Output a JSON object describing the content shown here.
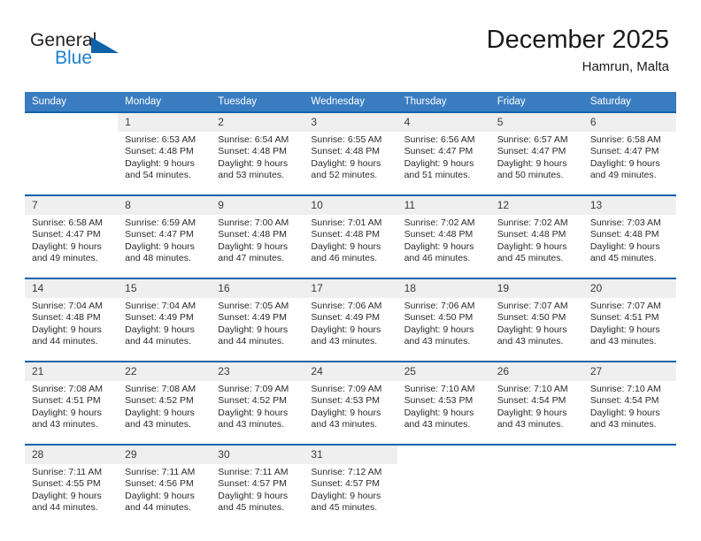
{
  "brand": {
    "name_part1": "General",
    "name_part2": "Blue",
    "triangle_color": "#1063a8",
    "blue_color": "#1d7fd0"
  },
  "header": {
    "month_title": "December 2025",
    "location": "Hamrun, Malta",
    "header_bg": "#3a7cc0",
    "separator_color": "#1063a8",
    "daynum_bg": "#efefef"
  },
  "weekday_headers": [
    "Sunday",
    "Monday",
    "Tuesday",
    "Wednesday",
    "Thursday",
    "Friday",
    "Saturday"
  ],
  "weeks": [
    {
      "days": [
        {
          "date": "",
          "lines": [
            "",
            "",
            "",
            ""
          ],
          "empty": true
        },
        {
          "date": "1",
          "lines": [
            "Sunrise: 6:53 AM",
            "Sunset: 4:48 PM",
            "Daylight: 9 hours",
            "and 54 minutes."
          ],
          "empty": false
        },
        {
          "date": "2",
          "lines": [
            "Sunrise: 6:54 AM",
            "Sunset: 4:48 PM",
            "Daylight: 9 hours",
            "and 53 minutes."
          ],
          "empty": false
        },
        {
          "date": "3",
          "lines": [
            "Sunrise: 6:55 AM",
            "Sunset: 4:48 PM",
            "Daylight: 9 hours",
            "and 52 minutes."
          ],
          "empty": false
        },
        {
          "date": "4",
          "lines": [
            "Sunrise: 6:56 AM",
            "Sunset: 4:47 PM",
            "Daylight: 9 hours",
            "and 51 minutes."
          ],
          "empty": false
        },
        {
          "date": "5",
          "lines": [
            "Sunrise: 6:57 AM",
            "Sunset: 4:47 PM",
            "Daylight: 9 hours",
            "and 50 minutes."
          ],
          "empty": false
        },
        {
          "date": "6",
          "lines": [
            "Sunrise: 6:58 AM",
            "Sunset: 4:47 PM",
            "Daylight: 9 hours",
            "and 49 minutes."
          ],
          "empty": false
        }
      ]
    },
    {
      "days": [
        {
          "date": "7",
          "lines": [
            "Sunrise: 6:58 AM",
            "Sunset: 4:47 PM",
            "Daylight: 9 hours",
            "and 49 minutes."
          ],
          "empty": false
        },
        {
          "date": "8",
          "lines": [
            "Sunrise: 6:59 AM",
            "Sunset: 4:47 PM",
            "Daylight: 9 hours",
            "and 48 minutes."
          ],
          "empty": false
        },
        {
          "date": "9",
          "lines": [
            "Sunrise: 7:00 AM",
            "Sunset: 4:48 PM",
            "Daylight: 9 hours",
            "and 47 minutes."
          ],
          "empty": false
        },
        {
          "date": "10",
          "lines": [
            "Sunrise: 7:01 AM",
            "Sunset: 4:48 PM",
            "Daylight: 9 hours",
            "and 46 minutes."
          ],
          "empty": false
        },
        {
          "date": "11",
          "lines": [
            "Sunrise: 7:02 AM",
            "Sunset: 4:48 PM",
            "Daylight: 9 hours",
            "and 46 minutes."
          ],
          "empty": false
        },
        {
          "date": "12",
          "lines": [
            "Sunrise: 7:02 AM",
            "Sunset: 4:48 PM",
            "Daylight: 9 hours",
            "and 45 minutes."
          ],
          "empty": false
        },
        {
          "date": "13",
          "lines": [
            "Sunrise: 7:03 AM",
            "Sunset: 4:48 PM",
            "Daylight: 9 hours",
            "and 45 minutes."
          ],
          "empty": false
        }
      ]
    },
    {
      "days": [
        {
          "date": "14",
          "lines": [
            "Sunrise: 7:04 AM",
            "Sunset: 4:48 PM",
            "Daylight: 9 hours",
            "and 44 minutes."
          ],
          "empty": false
        },
        {
          "date": "15",
          "lines": [
            "Sunrise: 7:04 AM",
            "Sunset: 4:49 PM",
            "Daylight: 9 hours",
            "and 44 minutes."
          ],
          "empty": false
        },
        {
          "date": "16",
          "lines": [
            "Sunrise: 7:05 AM",
            "Sunset: 4:49 PM",
            "Daylight: 9 hours",
            "and 44 minutes."
          ],
          "empty": false
        },
        {
          "date": "17",
          "lines": [
            "Sunrise: 7:06 AM",
            "Sunset: 4:49 PM",
            "Daylight: 9 hours",
            "and 43 minutes."
          ],
          "empty": false
        },
        {
          "date": "18",
          "lines": [
            "Sunrise: 7:06 AM",
            "Sunset: 4:50 PM",
            "Daylight: 9 hours",
            "and 43 minutes."
          ],
          "empty": false
        },
        {
          "date": "19",
          "lines": [
            "Sunrise: 7:07 AM",
            "Sunset: 4:50 PM",
            "Daylight: 9 hours",
            "and 43 minutes."
          ],
          "empty": false
        },
        {
          "date": "20",
          "lines": [
            "Sunrise: 7:07 AM",
            "Sunset: 4:51 PM",
            "Daylight: 9 hours",
            "and 43 minutes."
          ],
          "empty": false
        }
      ]
    },
    {
      "days": [
        {
          "date": "21",
          "lines": [
            "Sunrise: 7:08 AM",
            "Sunset: 4:51 PM",
            "Daylight: 9 hours",
            "and 43 minutes."
          ],
          "empty": false
        },
        {
          "date": "22",
          "lines": [
            "Sunrise: 7:08 AM",
            "Sunset: 4:52 PM",
            "Daylight: 9 hours",
            "and 43 minutes."
          ],
          "empty": false
        },
        {
          "date": "23",
          "lines": [
            "Sunrise: 7:09 AM",
            "Sunset: 4:52 PM",
            "Daylight: 9 hours",
            "and 43 minutes."
          ],
          "empty": false
        },
        {
          "date": "24",
          "lines": [
            "Sunrise: 7:09 AM",
            "Sunset: 4:53 PM",
            "Daylight: 9 hours",
            "and 43 minutes."
          ],
          "empty": false
        },
        {
          "date": "25",
          "lines": [
            "Sunrise: 7:10 AM",
            "Sunset: 4:53 PM",
            "Daylight: 9 hours",
            "and 43 minutes."
          ],
          "empty": false
        },
        {
          "date": "26",
          "lines": [
            "Sunrise: 7:10 AM",
            "Sunset: 4:54 PM",
            "Daylight: 9 hours",
            "and 43 minutes."
          ],
          "empty": false
        },
        {
          "date": "27",
          "lines": [
            "Sunrise: 7:10 AM",
            "Sunset: 4:54 PM",
            "Daylight: 9 hours",
            "and 43 minutes."
          ],
          "empty": false
        }
      ]
    },
    {
      "days": [
        {
          "date": "28",
          "lines": [
            "Sunrise: 7:11 AM",
            "Sunset: 4:55 PM",
            "Daylight: 9 hours",
            "and 44 minutes."
          ],
          "empty": false
        },
        {
          "date": "29",
          "lines": [
            "Sunrise: 7:11 AM",
            "Sunset: 4:56 PM",
            "Daylight: 9 hours",
            "and 44 minutes."
          ],
          "empty": false
        },
        {
          "date": "30",
          "lines": [
            "Sunrise: 7:11 AM",
            "Sunset: 4:57 PM",
            "Daylight: 9 hours",
            "and 45 minutes."
          ],
          "empty": false
        },
        {
          "date": "31",
          "lines": [
            "Sunrise: 7:12 AM",
            "Sunset: 4:57 PM",
            "Daylight: 9 hours",
            "and 45 minutes."
          ],
          "empty": false
        },
        {
          "date": "",
          "lines": [
            "",
            "",
            "",
            ""
          ],
          "empty": true
        },
        {
          "date": "",
          "lines": [
            "",
            "",
            "",
            ""
          ],
          "empty": true
        },
        {
          "date": "",
          "lines": [
            "",
            "",
            "",
            ""
          ],
          "empty": true
        }
      ]
    }
  ]
}
